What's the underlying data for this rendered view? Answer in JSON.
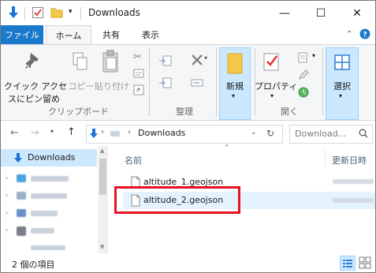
{
  "window": {
    "title": "Downloads",
    "controls": {
      "minimize": "—",
      "maximize": "☐",
      "close": "✕"
    }
  },
  "tabs": [
    {
      "label": "ファイル"
    },
    {
      "label": "ホーム"
    },
    {
      "label": "共有"
    },
    {
      "label": "表示"
    }
  ],
  "ribbon": {
    "quick_access_label_1": "クイック アクセ",
    "quick_access_label_2": "スにピン留め",
    "copy_label": "コピー",
    "paste_label": "貼り付け",
    "clipboard_group": "クリップボード",
    "organize_group": "整理",
    "new_label": "新規",
    "properties_label": "プロパティ",
    "open_group": "開く",
    "select_label": "選択"
  },
  "address": {
    "path": "Downloads",
    "search_placeholder": "Download..."
  },
  "navigation": {
    "items": [
      {
        "label": "Downloads",
        "selected": true
      }
    ]
  },
  "columns": {
    "name": "名前",
    "modified": "更新日時"
  },
  "files": [
    {
      "name": "altitude_1.geojson"
    },
    {
      "name": "altitude_2.geojson"
    }
  ],
  "status": {
    "count_text": "2 個の項目"
  },
  "colors": {
    "accent": "#1979ca",
    "highlight_box": "#e81123",
    "selection": "#cce8ff"
  }
}
